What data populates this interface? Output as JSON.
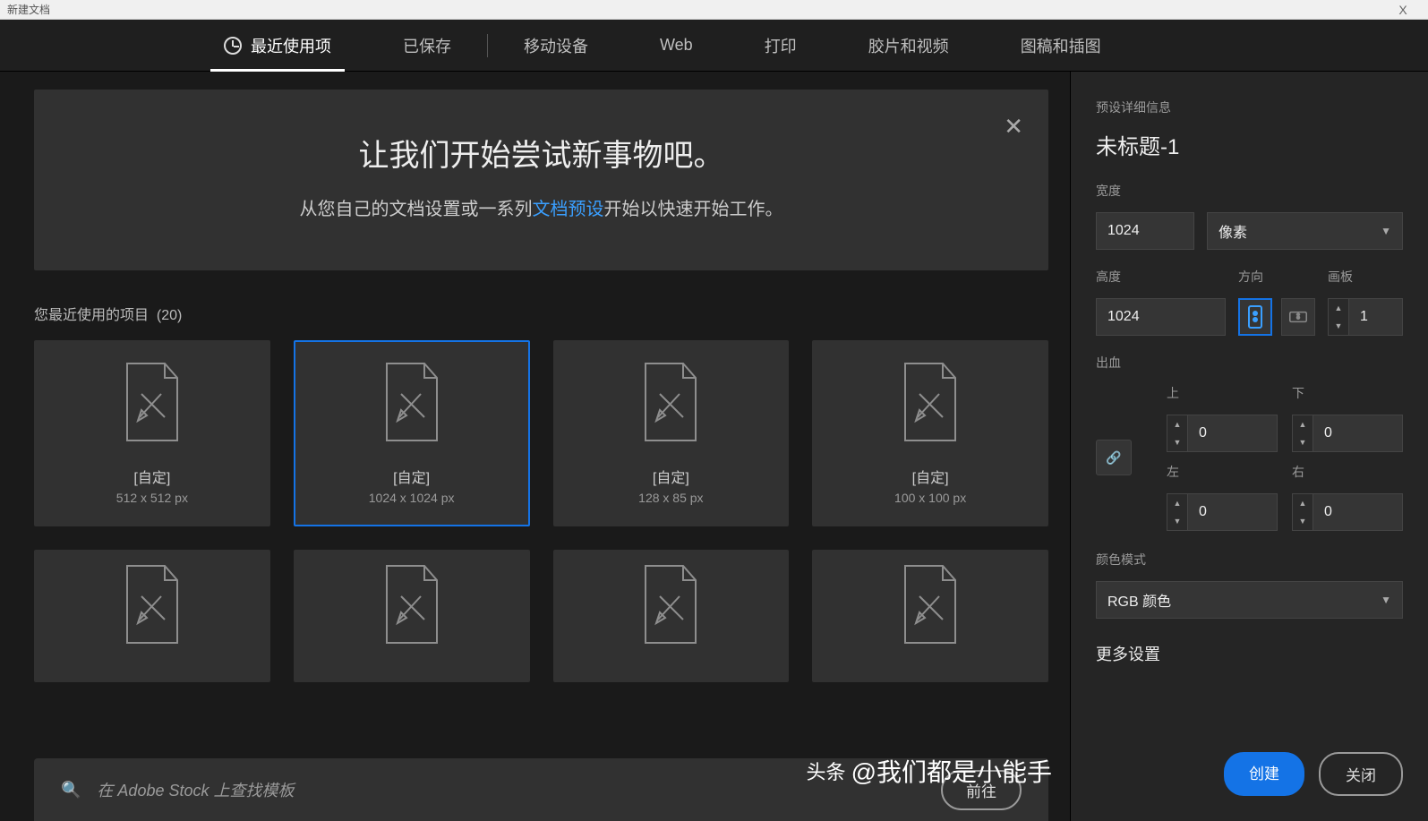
{
  "window": {
    "title": "新建文档",
    "closeLabel": "X"
  },
  "tabs": {
    "recent": "最近使用项",
    "saved": "已保存",
    "mobile": "移动设备",
    "web": "Web",
    "print": "打印",
    "film": "胶片和视频",
    "illustration": "图稿和插图"
  },
  "hero": {
    "title": "让我们开始尝试新事物吧。",
    "before": "从您自己的文档设置或一系列",
    "link": "文档预设",
    "after": "开始以快速开始工作。"
  },
  "recentSection": {
    "label": "您最近使用的项目",
    "count": "(20)"
  },
  "cards": [
    {
      "label": "[自定]",
      "dim": "512 x 512 px"
    },
    {
      "label": "[自定]",
      "dim": "1024 x 1024 px"
    },
    {
      "label": "[自定]",
      "dim": "128 x 85 px"
    },
    {
      "label": "[自定]",
      "dim": "100 x 100 px"
    }
  ],
  "search": {
    "placeholder": "在 Adobe Stock 上查找模板",
    "go": "前往"
  },
  "panel": {
    "headerLabel": "预设详细信息",
    "docName": "未标题-1",
    "widthLabel": "宽度",
    "width": "1024",
    "unit": "像素",
    "heightLabel": "高度",
    "height": "1024",
    "orientLabel": "方向",
    "artboardLabel": "画板",
    "artboards": "1",
    "bleedLabel": "出血",
    "top": "上",
    "bottom": "下",
    "left": "左",
    "right": "右",
    "bleedTop": "0",
    "bleedBottom": "0",
    "bleedLeft": "0",
    "bleedRight": "0",
    "colorModeLabel": "颜色模式",
    "colorMode": "RGB 颜色",
    "moreSettings": "更多设置",
    "create": "创建",
    "close": "关闭"
  },
  "watermark": {
    "logo": "头条",
    "text": "@我们都是小能手"
  }
}
